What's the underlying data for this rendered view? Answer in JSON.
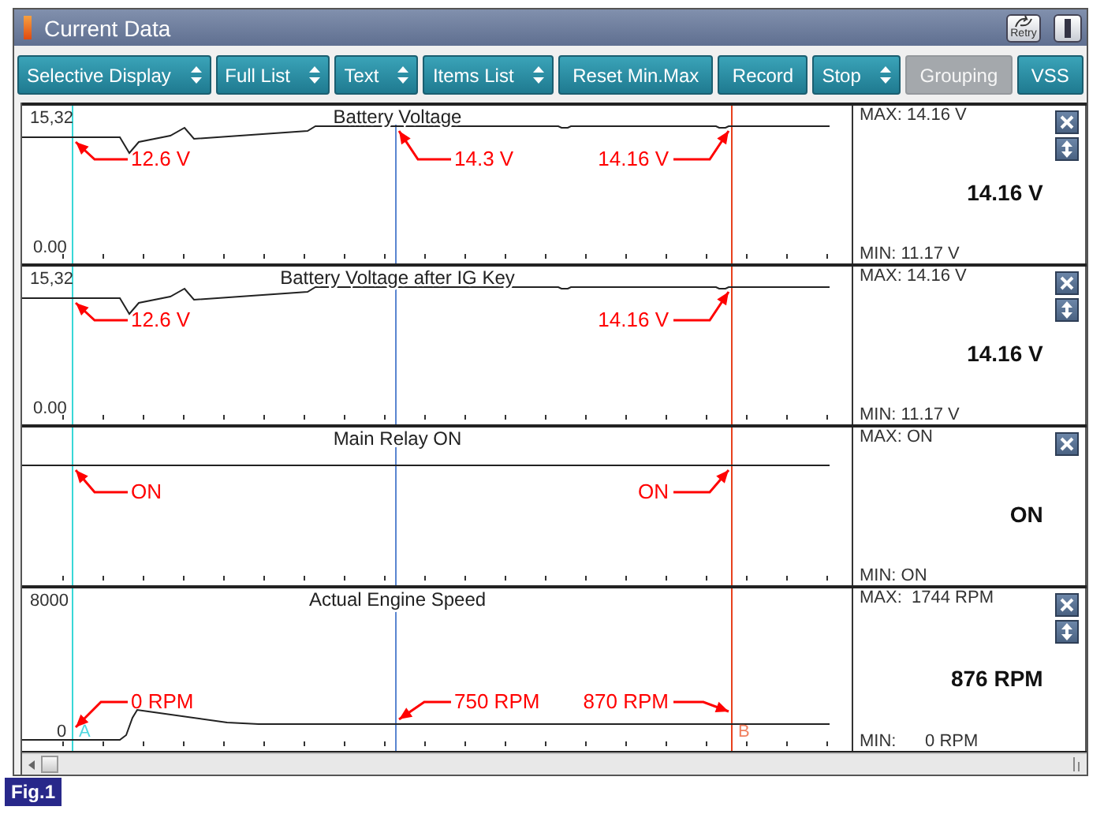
{
  "window": {
    "title": "Current Data",
    "retry_label": "Retry"
  },
  "toolbar": [
    {
      "label": "Selective Display",
      "kind": "dropdown",
      "disabled": false
    },
    {
      "label": "Full List",
      "kind": "dropdown",
      "disabled": false
    },
    {
      "label": "Text",
      "kind": "dropdown",
      "disabled": false
    },
    {
      "label": "Items List",
      "kind": "dropdown",
      "disabled": false
    },
    {
      "label": "Reset Min.Max",
      "kind": "plain",
      "disabled": false
    },
    {
      "label": "Record",
      "kind": "plain",
      "disabled": false
    },
    {
      "label": "Stop",
      "kind": "dropdown",
      "disabled": false
    },
    {
      "label": "Grouping",
      "kind": "plain",
      "disabled": true
    },
    {
      "label": "VSS",
      "kind": "plain",
      "disabled": false
    }
  ],
  "panels": [
    {
      "title": "Battery Voltage",
      "kind": "voltage",
      "scale_max": "15,32",
      "scale_min": "0.00",
      "max": "MAX: 14.16 V",
      "value": "14.16 V",
      "min": "MIN: 11.17 V",
      "movable": true,
      "callouts": {
        "left": "12.6 V",
        "middle": "14.3 V",
        "right": "14.16 V"
      }
    },
    {
      "title": "Battery Voltage after IG Key",
      "kind": "voltage",
      "scale_max": "15,32",
      "scale_min": "0.00",
      "max": "MAX: 14.16 V",
      "value": "14.16 V",
      "min": "MIN: 11.17 V",
      "movable": true,
      "callouts": {
        "left": "12.6 V",
        "right": "14.16 V"
      }
    },
    {
      "title": "Main Relay ON",
      "kind": "switch",
      "max": "MAX: ON",
      "value": "ON",
      "min": "MIN: ON",
      "movable": false,
      "callouts": {
        "left": "ON",
        "right": "ON"
      }
    },
    {
      "title": "Actual Engine Speed",
      "kind": "rpm",
      "scale_max": "8000",
      "scale_min": "0",
      "max": "MAX:  1744 RPM",
      "value": "876 RPM",
      "min": "MIN:      0 RPM",
      "movable": true,
      "callouts": {
        "left": "0 RPM",
        "middle": "750 RPM",
        "right": "870 RPM"
      },
      "markers": {
        "left": "A",
        "right": "B"
      }
    }
  ],
  "figure_label": "Fig.1"
}
